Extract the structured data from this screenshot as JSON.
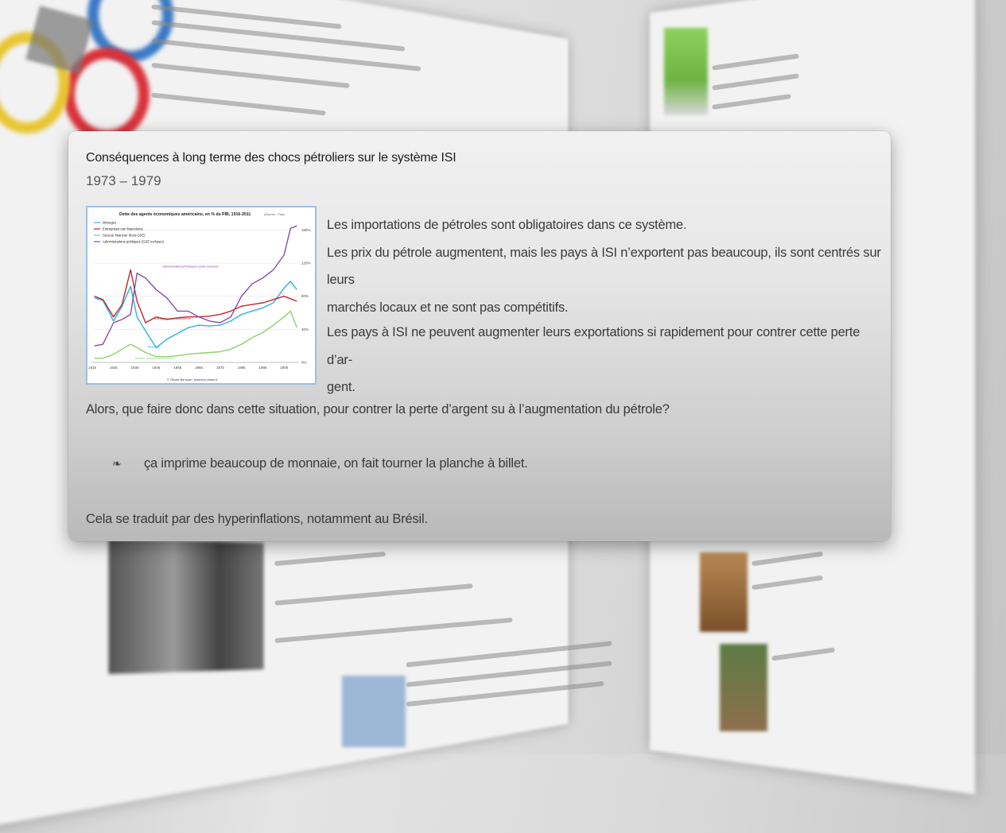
{
  "popover": {
    "title": "Conséquences à long terme des chocs pétroliers sur le système ISI",
    "subtitle": "1973 – 1979",
    "paragraph1_lines": [
      "Les importations de pétroles sont obligatoires dans ce système.",
      "Les prix du pétrole augmentent, mais les pays à ISI n’exportent pas beaucoup, ils sont centrés sur leurs",
      "marchés locaux et ne sont pas compétitifs."
    ],
    "paragraph2_lines": [
      "Les pays à ISI ne peuvent augmenter leurs exportations si rapidement pour contrer cette perte d’ar-",
      "gent."
    ],
    "question": "Alors, que faire donc dans cette situation, pour contrer la perte d’argent su à l’augmentation du pétrole?",
    "bullet_glyph": "❧",
    "bullet_text": "ça imprime beaucoup de monnaie, on fait tourner la planche à billet.",
    "conclusion": "Cela se traduit par des hyperinflations, notamment au Brésil."
  },
  "colors": {
    "households": "#2bb3e0",
    "firms": "#c0282e",
    "financial": "#8ed16b",
    "public": "#8a4ca6",
    "frame": "#9fbfe0"
  },
  "chart_data": {
    "type": "line",
    "title": "Dette des agents économiques américains, en % du PIB, 1916-2011",
    "title_note": "(Source : Fed)",
    "credit": "© Olivier Berruyer, www.les-crises.fr",
    "x": [
      1916,
      1920,
      1925,
      1929,
      1933,
      1936,
      1940,
      1945,
      1950,
      1955,
      1960,
      1965,
      1970,
      1975,
      1980,
      1985,
      1990,
      1995,
      2000,
      2005,
      2008,
      2011
    ],
    "xticks": [
      "1915",
      "1925",
      "1935",
      "1945",
      "1955",
      "1965",
      "1975",
      "1985",
      "1995",
      "2005"
    ],
    "yticks": [
      "0%",
      "40%",
      "80%",
      "120%",
      "160%"
    ],
    "ylim": [
      0,
      170
    ],
    "series": [
      {
        "name": "Ménages",
        "color_key": "households",
        "values": [
          78,
          75,
          50,
          68,
          92,
          55,
          38,
          18,
          28,
          35,
          42,
          45,
          44,
          45,
          50,
          58,
          62,
          66,
          72,
          90,
          98,
          88
        ]
      },
      {
        "name": "Entreprises non financières",
        "color_key": "firms",
        "values": [
          80,
          76,
          55,
          70,
          112,
          74,
          48,
          55,
          52,
          54,
          55,
          55,
          56,
          58,
          62,
          68,
          70,
          72,
          76,
          80,
          77,
          74
        ]
      },
      {
        "name": "Secteur financier (hors GSE)",
        "color_key": "financial",
        "values": [
          5,
          5,
          10,
          16,
          22,
          18,
          12,
          7,
          7,
          8,
          10,
          11,
          12,
          13,
          16,
          22,
          30,
          36,
          45,
          55,
          62,
          42
        ]
      },
      {
        "name": "Administrations publiques (GSE incluses)",
        "color_key": "public",
        "values": [
          20,
          22,
          48,
          52,
          58,
          108,
          102,
          88,
          78,
          62,
          62,
          55,
          50,
          48,
          55,
          80,
          95,
          102,
          112,
          130,
          162,
          165
        ]
      }
    ],
    "annotations": [
      "Administrations/Publiques (GSE incluses)",
      "Entreprises non financières",
      "Ménages",
      "Secteur financier (hors GSE)"
    ]
  }
}
